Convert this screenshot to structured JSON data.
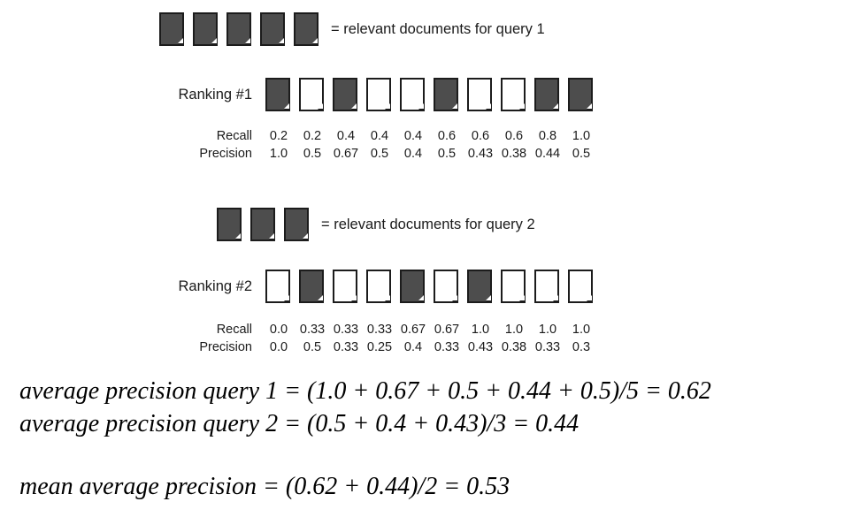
{
  "legends": [
    {
      "icon": "document-icon",
      "count": 5,
      "label": "= relevant documents for query 1"
    },
    {
      "icon": "document-icon",
      "count": 3,
      "label": "= relevant documents for query 2"
    }
  ],
  "rankings": [
    {
      "title": "Ranking #1",
      "documents": [
        "relevant",
        "not-relevant",
        "relevant",
        "not-relevant",
        "not-relevant",
        "relevant",
        "not-relevant",
        "not-relevant",
        "relevant",
        "relevant"
      ],
      "metrics": [
        {
          "name": "Recall",
          "values": [
            "0.2",
            "0.2",
            "0.4",
            "0.4",
            "0.4",
            "0.6",
            "0.6",
            "0.6",
            "0.8",
            "1.0"
          ]
        },
        {
          "name": "Precision",
          "values": [
            "1.0",
            "0.5",
            "0.67",
            "0.5",
            "0.4",
            "0.5",
            "0.43",
            "0.38",
            "0.44",
            "0.5"
          ]
        }
      ]
    },
    {
      "title": "Ranking #2",
      "documents": [
        "not-relevant",
        "relevant",
        "not-relevant",
        "not-relevant",
        "relevant",
        "not-relevant",
        "relevant",
        "not-relevant",
        "not-relevant",
        "not-relevant"
      ],
      "metrics": [
        {
          "name": "Recall",
          "values": [
            "0.0",
            "0.33",
            "0.33",
            "0.33",
            "0.67",
            "0.67",
            "1.0",
            "1.0",
            "1.0",
            "1.0"
          ]
        },
        {
          "name": "Precision",
          "values": [
            "0.0",
            "0.5",
            "0.33",
            "0.25",
            "0.4",
            "0.33",
            "0.43",
            "0.38",
            "0.33",
            "0.3"
          ]
        }
      ]
    }
  ],
  "equations": [
    {
      "text": "average precision query 1 = (1.0 + 0.67 + 0.5 + 0.44 + 0.5)/5 = 0.62",
      "gap_before": false
    },
    {
      "text": "average precision query 2 = (0.5 + 0.4 + 0.43)/3 = 0.44",
      "gap_before": false
    },
    {
      "text": "mean average precision = (0.62 + 0.44)/2 = 0.53",
      "gap_before": true
    }
  ],
  "colors": {
    "relevant_fill": "#4d4d4d",
    "not_relevant_fill": "#ffffff",
    "outline": "#1c1c1c",
    "text": "#1a1a1a",
    "background": "#ffffff"
  }
}
